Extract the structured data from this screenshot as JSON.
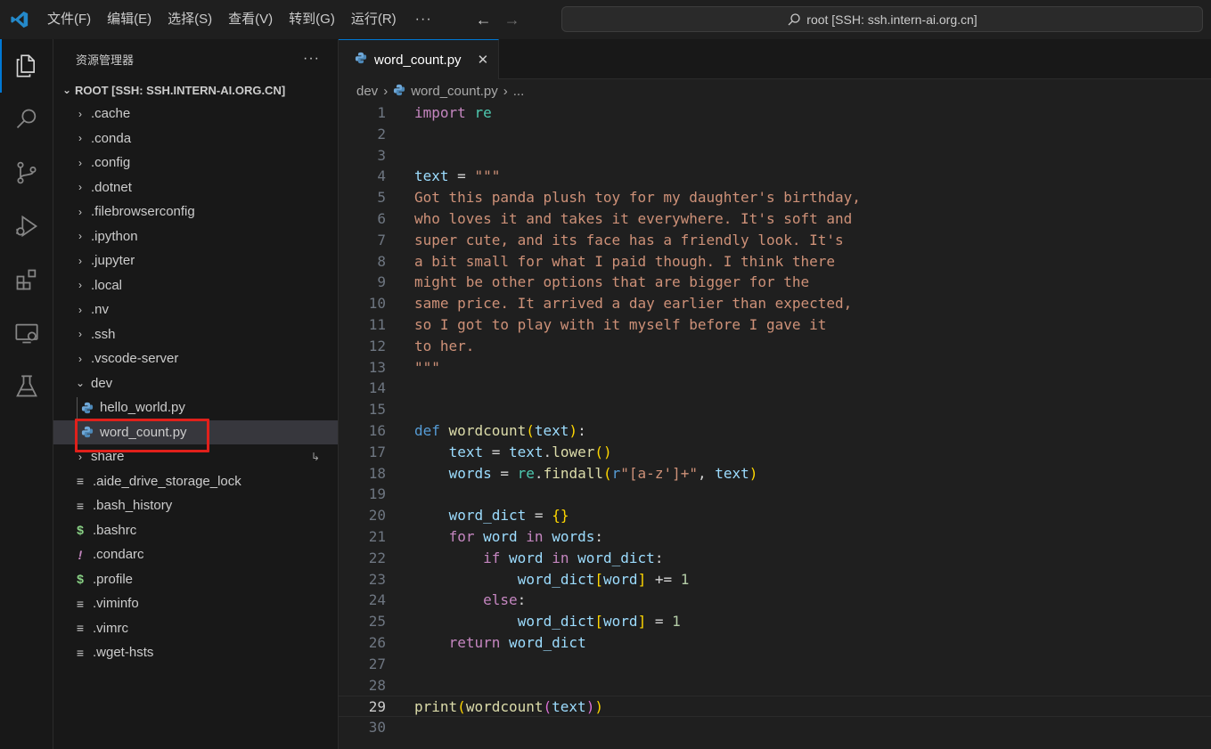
{
  "colors": {
    "accent": "#0078d4",
    "highlight_box": "#e0201b",
    "background": "#1f1f1f"
  },
  "menu": [
    "文件(F)",
    "编辑(E)",
    "选择(S)",
    "查看(V)",
    "转到(G)",
    "运行(R)"
  ],
  "command_center": {
    "text": "root [SSH: ssh.intern-ai.org.cn]"
  },
  "activity_bar": [
    "files-icon",
    "search-icon",
    "source-control-icon",
    "run-debug-icon",
    "extensions-icon",
    "remote-explorer-icon",
    "testing-icon"
  ],
  "explorer": {
    "title": "资源管理器",
    "root": "ROOT [SSH: SSH.INTERN-AI.ORG.CN]",
    "folders": [
      ".cache",
      ".conda",
      ".config",
      ".dotnet",
      ".filebrowserconfig",
      ".ipython",
      ".jupyter",
      ".local",
      ".nv",
      ".ssh",
      ".vscode-server"
    ],
    "open_folder": "dev",
    "dev_files": [
      "hello_world.py",
      "word_count.py"
    ],
    "after_folder": "share",
    "files": [
      {
        "name": ".aide_drive_storage_lock",
        "icon": "lines-icon"
      },
      {
        "name": ".bash_history",
        "icon": "lines-icon"
      },
      {
        "name": ".bashrc",
        "icon": "dollar-icon"
      },
      {
        "name": ".condarc",
        "icon": "exclaim-icon"
      },
      {
        "name": ".profile",
        "icon": "dollar-icon"
      },
      {
        "name": ".viminfo",
        "icon": "lines-icon"
      },
      {
        "name": ".vimrc",
        "icon": "lines-icon"
      },
      {
        "name": ".wget-hsts",
        "icon": "lines-icon"
      }
    ]
  },
  "tab": {
    "label": "word_count.py"
  },
  "breadcrumb": {
    "folder": "dev",
    "file": "word_count.py",
    "more": "..."
  },
  "editor": {
    "line_numbers": [
      "1",
      "2",
      "3",
      "4",
      "5",
      "6",
      "7",
      "8",
      "9",
      "10",
      "11",
      "12",
      "13",
      "14",
      "15",
      "16",
      "17",
      "18",
      "19",
      "20",
      "21",
      "22",
      "23",
      "24",
      "25",
      "26",
      "27",
      "28",
      "29",
      "30"
    ],
    "current_line": 29,
    "lines": [
      "import re",
      "",
      "",
      "text = \"\"\"",
      "Got this panda plush toy for my daughter's birthday,",
      "who loves it and takes it everywhere. It's soft and",
      "super cute, and its face has a friendly look. It's",
      "a bit small for what I paid though. I think there",
      "might be other options that are bigger for the",
      "same price. It arrived a day earlier than expected,",
      "so I got to play with it myself before I gave it",
      "to her.",
      "\"\"\"",
      "",
      "",
      "def wordcount(text):",
      "    text = text.lower()",
      "    words = re.findall(r\"[a-z']+\", text)",
      "",
      "    word_dict = {}",
      "    for word in words:",
      "        if word in word_dict:",
      "            word_dict[word] += 1",
      "        else:",
      "            word_dict[word] = 1",
      "    return word_dict",
      "",
      "",
      "print(wordcount(text))",
      ""
    ]
  }
}
